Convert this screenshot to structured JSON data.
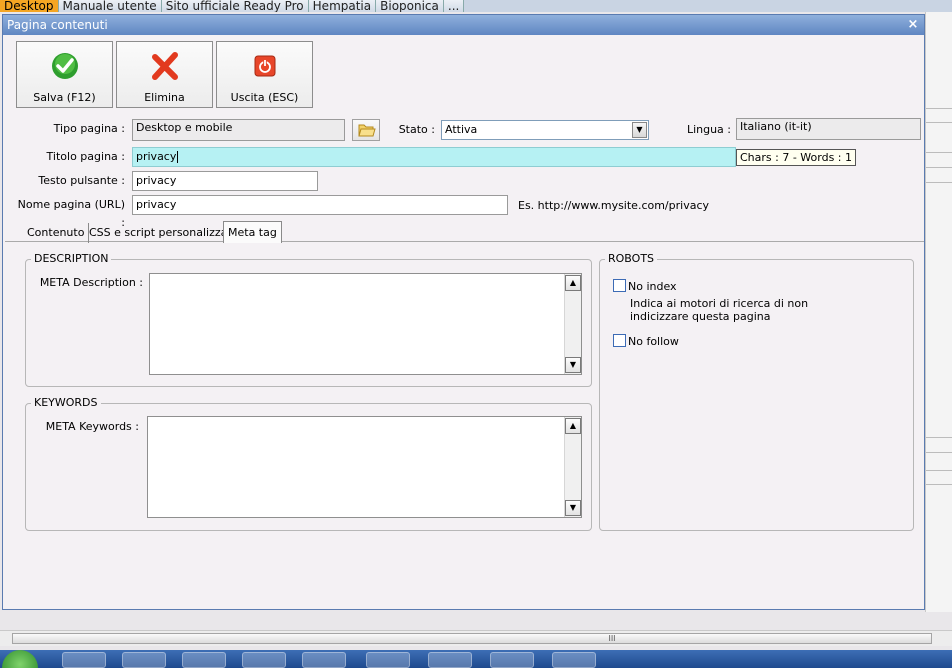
{
  "host_tabs": [
    "Desktop",
    "Manuale utente",
    "Sito ufficiale Ready Pro",
    "Hempatia",
    "Bioponica",
    "..."
  ],
  "dialog": {
    "title": "Pagina contenuti",
    "close": "×"
  },
  "toolbar": {
    "save": "Salva (F12)",
    "delete": "Elimina",
    "exit": "Uscita (ESC)"
  },
  "form": {
    "tipo_label": "Tipo pagina :",
    "tipo_value": "Desktop e mobile",
    "stato_label": "Stato :",
    "stato_value": "Attiva",
    "lingua_label": "Lingua :",
    "lingua_value": "Italiano (it-it)",
    "titolo_label": "Titolo pagina :",
    "titolo_value": "privacy",
    "titolo_tooltip": "Chars : 7 - Words : 1",
    "pulsante_label": "Testo pulsante :",
    "pulsante_value": "privacy",
    "url_label": "Nome pagina (URL) :",
    "url_value": "privacy",
    "url_hint": "Es. http://www.mysite.com/privacy"
  },
  "tabs": [
    {
      "label": "Contenuto"
    },
    {
      "label": "CSS e script personalizzati"
    },
    {
      "label": "Meta tag"
    }
  ],
  "meta": {
    "description_group": "DESCRIPTION",
    "description_label": "META Description :",
    "keywords_group": "KEYWORDS",
    "keywords_label": "META Keywords :",
    "robots_group": "ROBOTS",
    "noindex_label": "No index",
    "noindex_desc": "Indica ai motori di ricerca di non indicizzare questa pagina",
    "nofollow_label": "No follow"
  },
  "colors": {
    "title_field_bg": "#b6f1f3",
    "titlebar": "#5f86c2",
    "active_host_tab": "#f5a623"
  },
  "icons": {
    "save": "check-circle-icon",
    "delete": "red-x-icon",
    "exit": "power-icon",
    "folder": "folder-icon"
  },
  "hscroll_grip": "III"
}
